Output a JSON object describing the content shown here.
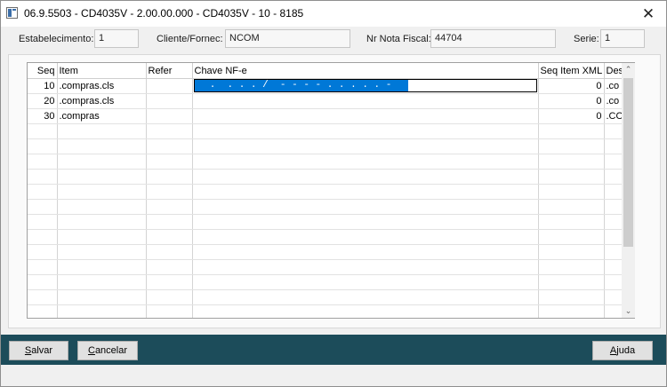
{
  "window": {
    "title": "06.9.5503 - CD4035V - 2.00.00.000 - CD4035V - 10 - 8185",
    "icon": "app-window-icon",
    "close_symbol": "✕"
  },
  "header": {
    "estabelecimento_label": "Estabelecimento:",
    "estabelecimento_value": "1",
    "cliente_label": "Cliente/Fornec:",
    "cliente_value": "NCOM",
    "nota_label": "Nr Nota Fiscal:",
    "nota_value": "44704",
    "serie_label": "Serie:",
    "serie_value": "1"
  },
  "grid": {
    "columns": [
      "Seq",
      "Item",
      "Refer",
      "Chave NF-e",
      "Seq Item XML",
      "Des"
    ],
    "rows": [
      {
        "seq": "10",
        "item": ".compras.cls",
        "refer": "",
        "chave": "",
        "seq_xml": "0",
        "des": ".co"
      },
      {
        "seq": "20",
        "item": ".compras.cls",
        "refer": "",
        "chave": "",
        "seq_xml": "0",
        "des": ".co"
      },
      {
        "seq": "30",
        "item": ".compras",
        "refer": "",
        "chave": "",
        "seq_xml": "0",
        "des": ".CO"
      }
    ],
    "editing_mask": "  .  . . . /  - - - - . . . . . -",
    "selection_color": "#0078d7"
  },
  "scrollbar": {
    "up_symbol": "⌃",
    "down_symbol": "⌄"
  },
  "footer": {
    "background": "#1c4c5a",
    "salvar_first": "S",
    "salvar_rest": "alvar",
    "cancelar_first": "C",
    "cancelar_rest": "ancelar",
    "ajuda_first": "A",
    "ajuda_rest": "juda"
  }
}
